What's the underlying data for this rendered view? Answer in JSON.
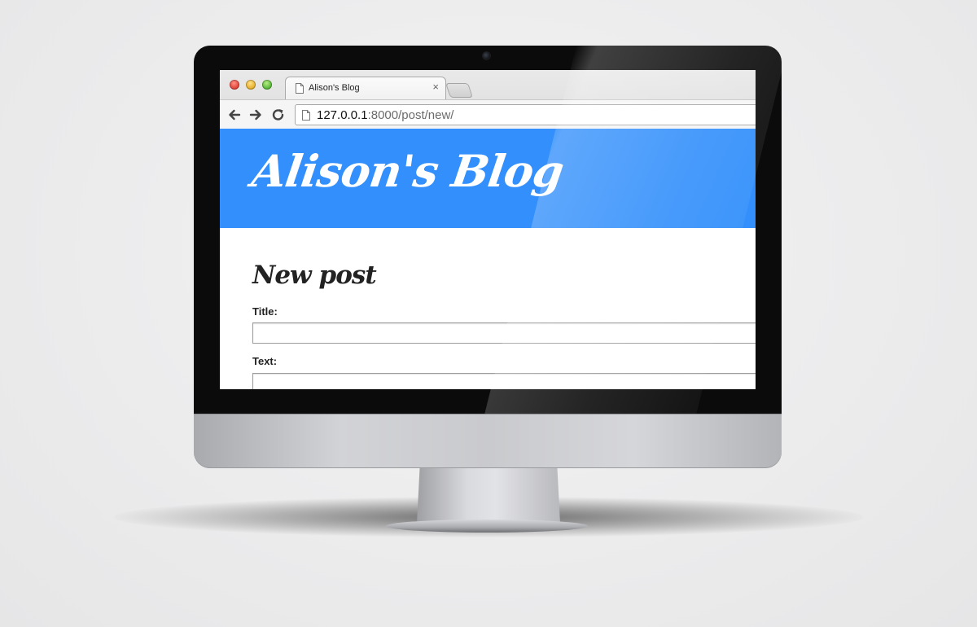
{
  "browser": {
    "tab_title": "Alison's Blog",
    "tab_close": "×",
    "url_host": "127.0.0.1",
    "url_path": ":8000/post/new/"
  },
  "page": {
    "site_title": "Alison's Blog",
    "heading": "New post",
    "form": {
      "title_label": "Title:",
      "text_label": "Text:",
      "title_value": "",
      "text_value": ""
    }
  },
  "colors": {
    "header_blue": "#328ffb",
    "bezel": "#0b0b0b"
  },
  "icons": {
    "traffic_close": "red-circle",
    "traffic_minimize": "yellow-circle",
    "traffic_zoom": "green-circle",
    "back": "arrow-left-icon",
    "forward": "arrow-right-icon",
    "reload": "reload-icon",
    "page": "page-icon"
  }
}
